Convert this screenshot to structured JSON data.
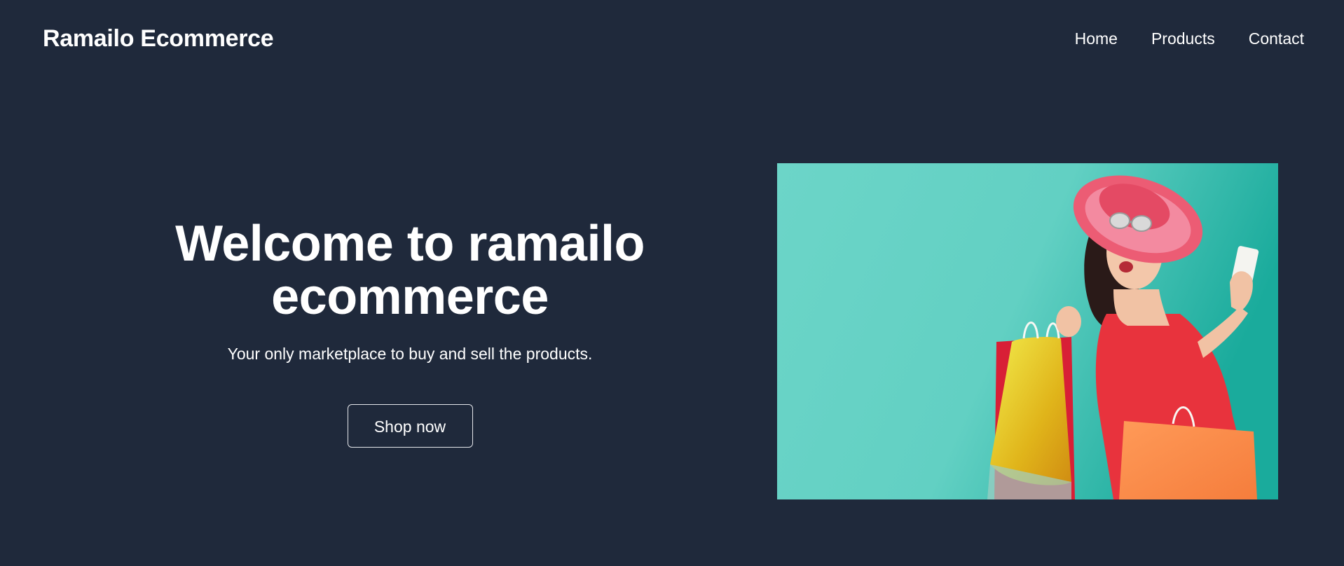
{
  "navbar": {
    "brand": "Ramailo Ecommerce",
    "links": [
      {
        "label": "Home"
      },
      {
        "label": "Products"
      },
      {
        "label": "Contact"
      }
    ]
  },
  "hero": {
    "title_line1": "Welcome to ramailo",
    "title_line2": "ecommerce",
    "subtitle": "Your only marketplace to buy and sell the products.",
    "cta_label": "Shop now",
    "image_alt": "woman-with-shopping-bags"
  },
  "colors": {
    "background": "#1f293b",
    "text": "#ffffff",
    "image_backdrop": "#66d2c6"
  }
}
